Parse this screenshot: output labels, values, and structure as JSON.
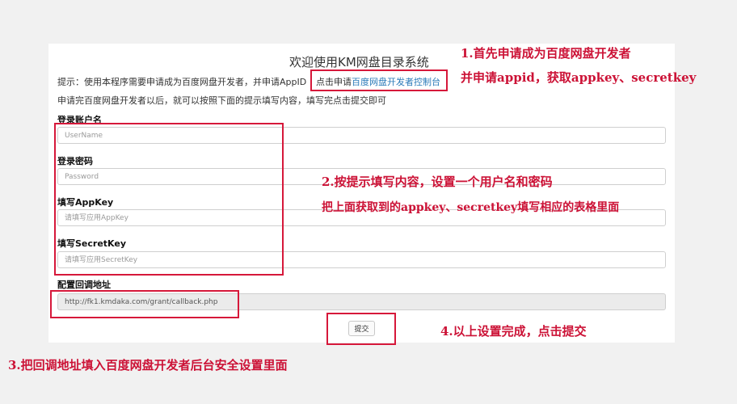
{
  "page": {
    "title": "欢迎使用KM网盘目录系统",
    "hint_text": "提示：使用本程序需要申请成为百度网盘开发者，并申请AppID",
    "console_prefix": "点击申请",
    "console_link": "百度网盘开发者控制台",
    "hint_line2": "申请完百度网盘开发者以后，就可以按照下面的提示填写内容，填写完点击提交即可"
  },
  "form": {
    "username": {
      "label": "登录账户名",
      "placeholder": "UserName",
      "value": ""
    },
    "password": {
      "label": "登录密码",
      "placeholder": "Password",
      "value": ""
    },
    "appkey": {
      "label": "填写AppKey",
      "placeholder": "请填写应用AppKey",
      "value": ""
    },
    "secretkey": {
      "label": "填写SecretKey",
      "placeholder": "请填写应用SecretKey",
      "value": ""
    },
    "callback": {
      "label": "配置回调地址",
      "value": "http://fk1.kmdaka.com/grant/callback.php"
    },
    "submit_label": "提交"
  },
  "annotations": {
    "step1_line1": "1.首先申请成为百度网盘开发者",
    "step1_line2": "并申请appid，获取appkey、secretkey",
    "step2_line1": "2.按提示填写内容，设置一个用户名和密码",
    "step2_line2": "把上面获取到的appkey、secretkey填写相应的表格里面",
    "step3": "3.把回调地址填入百度网盘开发者后台安全设置里面",
    "step4": "4.以上设置完成，点击提交"
  },
  "colors": {
    "annotation_red": "#cc1236",
    "link_blue": "#2a7ab8",
    "page_bg": "#f1f1f1"
  }
}
